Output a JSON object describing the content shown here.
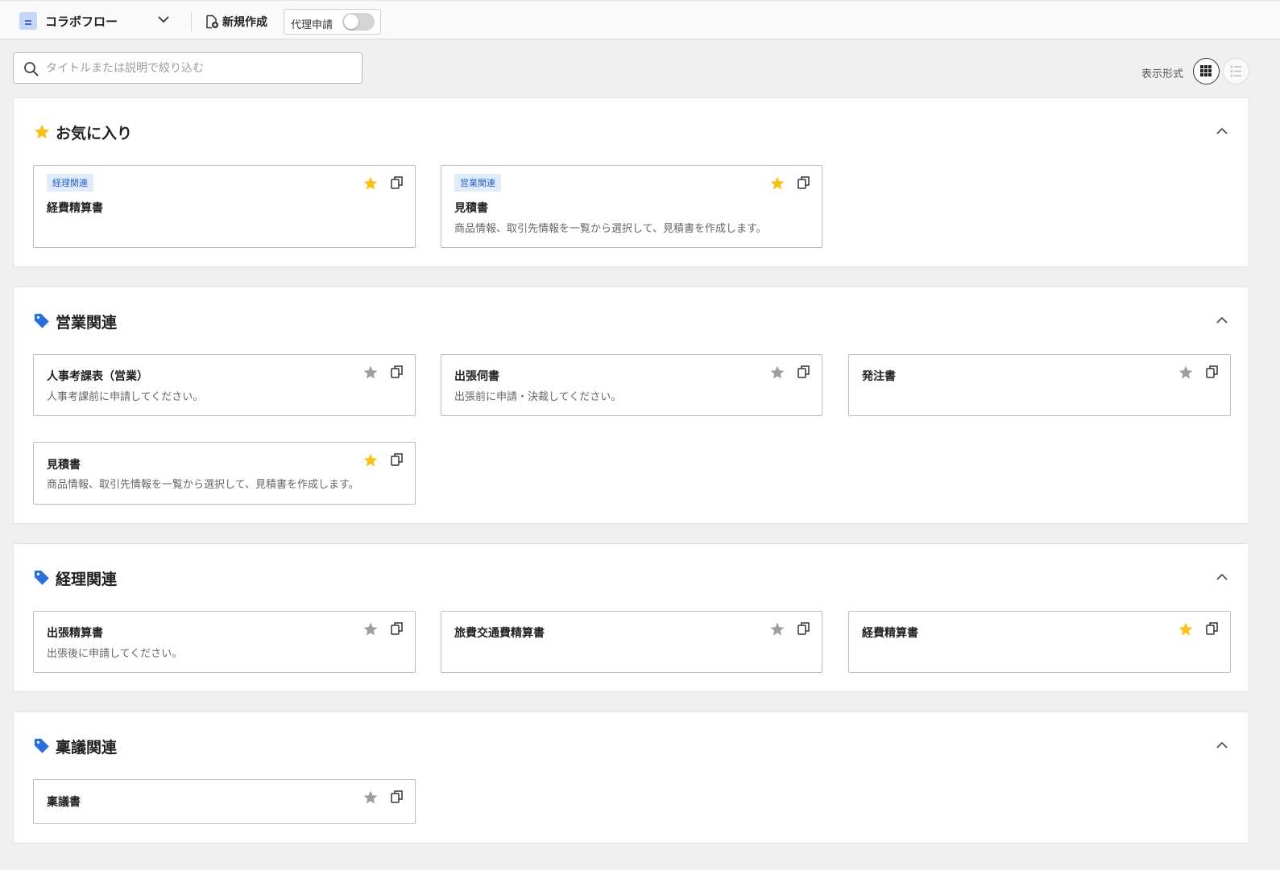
{
  "header": {
    "app_name": "コラボフロー",
    "new_label": "新規作成",
    "proxy_label": "代理申請"
  },
  "search": {
    "placeholder": "タイトルまたは説明で絞り込む"
  },
  "view": {
    "label": "表示形式"
  },
  "colors": {
    "star_on": "#f6c215",
    "star_off": "#9e9e9e",
    "tag_blue": "#2a6fdb"
  },
  "sections": [
    {
      "title": "お気に入り",
      "icon": "star-icon",
      "cards": [
        {
          "tag": "経理関連",
          "title": "経費精算書",
          "desc": "",
          "favorite": true
        },
        {
          "tag": "営業関連",
          "title": "見積書",
          "desc": "商品情報、取引先情報を一覧から選択して、見積書を作成します。",
          "favorite": true
        }
      ]
    },
    {
      "title": "営業関連",
      "icon": "tag-icon",
      "cards": [
        {
          "title": "人事考課表（営業）",
          "desc": "人事考課前に申請してください。",
          "favorite": false
        },
        {
          "title": "出張伺書",
          "desc": "出張前に申請・決裁してください。",
          "favorite": false
        },
        {
          "title": "発注書",
          "desc": "",
          "favorite": false
        },
        {
          "title": "見積書",
          "desc": "商品情報、取引先情報を一覧から選択して、見積書を作成します。",
          "favorite": true
        }
      ]
    },
    {
      "title": "経理関連",
      "icon": "tag-icon",
      "cards": [
        {
          "title": "出張精算書",
          "desc": "出張後に申請してください。",
          "favorite": false
        },
        {
          "title": "旅費交通費精算書",
          "desc": "",
          "favorite": false
        },
        {
          "title": "経費精算書",
          "desc": "",
          "favorite": true
        }
      ]
    },
    {
      "title": "稟議関連",
      "icon": "tag-icon",
      "cards": [
        {
          "title": "稟議書",
          "desc": "",
          "favorite": false
        }
      ]
    }
  ]
}
